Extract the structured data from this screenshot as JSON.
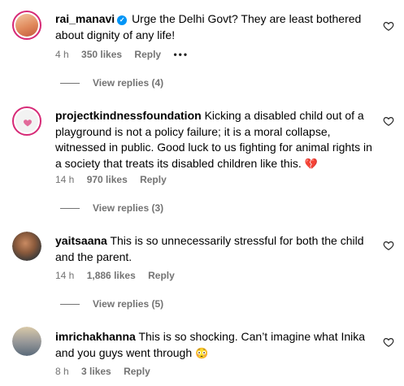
{
  "comments": [
    {
      "username": "rai_manavi",
      "verified": true,
      "text": "Urge the Delhi Govt? They are least bothered about dignity of any life!",
      "time": "4 h",
      "likes": "350 likes",
      "reply": "Reply",
      "more": "•••",
      "view_replies": "View replies (4)"
    },
    {
      "username": "projectkindnessfoundation",
      "text": "Kicking a disabled child out of a playground is not a policy failure; it is a moral collapse, witnessed in public. Good luck to us fighting for animal rights in a society that treats its disabled children like this.",
      "emoji": "💔",
      "time": "14 h",
      "likes": "970 likes",
      "reply": "Reply",
      "view_replies": "View replies (3)"
    },
    {
      "username": "yaitsaana",
      "text": "This is so unnecessarily stressful for both the child and the parent.",
      "time": "14 h",
      "likes": "1,886 likes",
      "reply": "Reply",
      "view_replies": "View replies (5)"
    },
    {
      "username": "imrichakhanna",
      "text": "This is so shocking. Can’t imagine what Inika and you guys went through",
      "emoji": "😳",
      "time": "8 h",
      "likes": "3 likes",
      "reply": "Reply"
    }
  ],
  "icons": {
    "like": "heart-outline-icon",
    "verified": "verified-badge-icon"
  },
  "colors": {
    "verified": "#0095f6",
    "story_ring": "#d62976",
    "muted_text": "#737373"
  }
}
